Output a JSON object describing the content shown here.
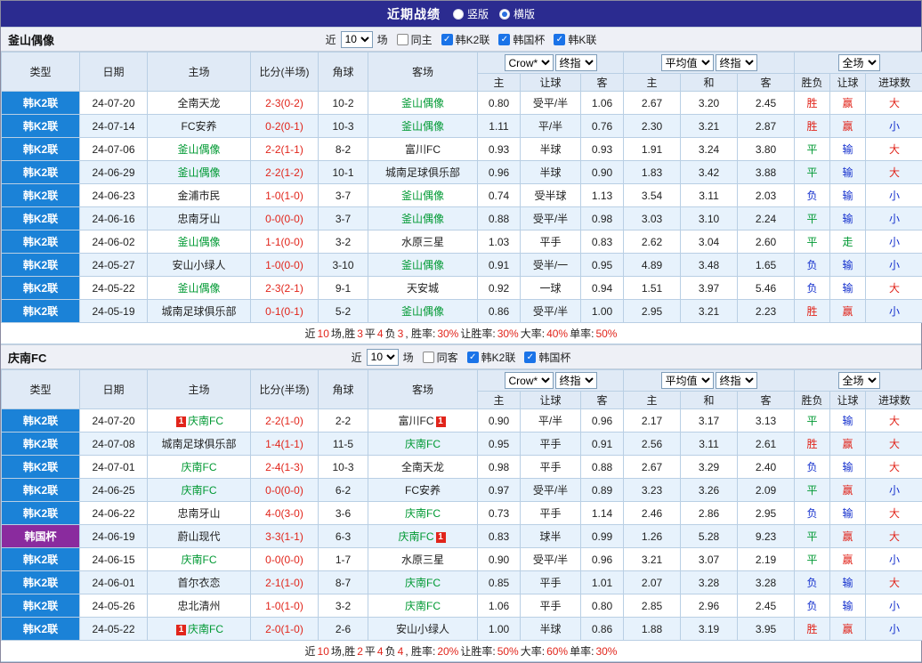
{
  "topbar": {
    "title": "近期战绩",
    "radios": [
      {
        "label": "竖版",
        "selected": false
      },
      {
        "label": "横版",
        "selected": true
      }
    ]
  },
  "table_header": {
    "cols": [
      "类型",
      "日期",
      "主场",
      "比分(半场)",
      "角球",
      "客场"
    ],
    "groups": [
      {
        "sel1": "Crow*",
        "sel2": "终指"
      },
      {
        "sel1": "平均值",
        "sel2": "终指"
      },
      {
        "sel1": "全场"
      }
    ],
    "sub": [
      "主",
      "让球",
      "客",
      "主",
      "和",
      "客",
      "胜负",
      "让球",
      "进球数"
    ]
  },
  "result_colors": {
    "胜": "red",
    "赢": "red",
    "大": "red",
    "平": "green",
    "走": "green",
    "负": "blue",
    "输": "blue",
    "小": "blue"
  },
  "colors": {
    "k2_league": "#1b82d7",
    "cup": "#8a2b9e",
    "win": "#e1251b",
    "draw": "#009933",
    "lose": "#1430cd",
    "focal_team": "#009933",
    "topbar_bg": "#2b2b90"
  },
  "sections": [
    {
      "team": "釜山偶像",
      "filters": {
        "near_label": "近",
        "count": "10",
        "games_label": "场",
        "checkboxes": [
          {
            "label": "同主",
            "checked": false
          },
          {
            "label": "韩K2联",
            "checked": true
          },
          {
            "label": "韩国杯",
            "checked": true
          },
          {
            "label": "韩K联",
            "checked": true
          }
        ]
      },
      "rows": [
        {
          "type": "韩K2联",
          "tclass": "k2",
          "date": "24-07-20",
          "home": "全南天龙",
          "hf": false,
          "hb": false,
          "score": "2-3(0-2)",
          "corner": "10-2",
          "away": "釜山偶像",
          "af": true,
          "ab": false,
          "odds": [
            "0.80",
            "受平/半",
            "1.06",
            "2.67",
            "3.20",
            "2.45"
          ],
          "res": [
            "胜",
            "赢",
            "大"
          ]
        },
        {
          "type": "韩K2联",
          "tclass": "k2",
          "date": "24-07-14",
          "home": "FC安养",
          "hf": false,
          "hb": false,
          "score": "0-2(0-1)",
          "corner": "10-3",
          "away": "釜山偶像",
          "af": true,
          "ab": false,
          "odds": [
            "1.11",
            "平/半",
            "0.76",
            "2.30",
            "3.21",
            "2.87"
          ],
          "res": [
            "胜",
            "赢",
            "小"
          ]
        },
        {
          "type": "韩K2联",
          "tclass": "k2",
          "date": "24-07-06",
          "home": "釜山偶像",
          "hf": true,
          "hb": false,
          "score": "2-2(1-1)",
          "corner": "8-2",
          "away": "富川FC",
          "af": false,
          "ab": false,
          "odds": [
            "0.93",
            "半球",
            "0.93",
            "1.91",
            "3.24",
            "3.80"
          ],
          "res": [
            "平",
            "输",
            "大"
          ]
        },
        {
          "type": "韩K2联",
          "tclass": "k2",
          "date": "24-06-29",
          "home": "釜山偶像",
          "hf": true,
          "hb": false,
          "score": "2-2(1-2)",
          "corner": "10-1",
          "away": "城南足球俱乐部",
          "af": false,
          "ab": false,
          "odds": [
            "0.96",
            "半球",
            "0.90",
            "1.83",
            "3.42",
            "3.88"
          ],
          "res": [
            "平",
            "输",
            "大"
          ]
        },
        {
          "type": "韩K2联",
          "tclass": "k2",
          "date": "24-06-23",
          "home": "金浦市民",
          "hf": false,
          "hb": false,
          "score": "1-0(1-0)",
          "corner": "3-7",
          "away": "釜山偶像",
          "af": true,
          "ab": false,
          "odds": [
            "0.74",
            "受半球",
            "1.13",
            "3.54",
            "3.11",
            "2.03"
          ],
          "res": [
            "负",
            "输",
            "小"
          ]
        },
        {
          "type": "韩K2联",
          "tclass": "k2",
          "date": "24-06-16",
          "home": "忠南牙山",
          "hf": false,
          "hb": false,
          "score": "0-0(0-0)",
          "corner": "3-7",
          "away": "釜山偶像",
          "af": true,
          "ab": false,
          "odds": [
            "0.88",
            "受平/半",
            "0.98",
            "3.03",
            "3.10",
            "2.24"
          ],
          "res": [
            "平",
            "输",
            "小"
          ]
        },
        {
          "type": "韩K2联",
          "tclass": "k2",
          "date": "24-06-02",
          "home": "釜山偶像",
          "hf": true,
          "hb": false,
          "score": "1-1(0-0)",
          "corner": "3-2",
          "away": "水原三星",
          "af": false,
          "ab": false,
          "odds": [
            "1.03",
            "平手",
            "0.83",
            "2.62",
            "3.04",
            "2.60"
          ],
          "res": [
            "平",
            "走",
            "小"
          ]
        },
        {
          "type": "韩K2联",
          "tclass": "k2",
          "date": "24-05-27",
          "home": "安山小绿人",
          "hf": false,
          "hb": false,
          "score": "1-0(0-0)",
          "corner": "3-10",
          "away": "釜山偶像",
          "af": true,
          "ab": false,
          "odds": [
            "0.91",
            "受半/一",
            "0.95",
            "4.89",
            "3.48",
            "1.65"
          ],
          "res": [
            "负",
            "输",
            "小"
          ]
        },
        {
          "type": "韩K2联",
          "tclass": "k2",
          "date": "24-05-22",
          "home": "釜山偶像",
          "hf": true,
          "hb": false,
          "score": "2-3(2-1)",
          "corner": "9-1",
          "away": "天安城",
          "af": false,
          "ab": false,
          "odds": [
            "0.92",
            "一球",
            "0.94",
            "1.51",
            "3.97",
            "5.46"
          ],
          "res": [
            "负",
            "输",
            "大"
          ]
        },
        {
          "type": "韩K2联",
          "tclass": "k2",
          "date": "24-05-19",
          "home": "城南足球俱乐部",
          "hf": false,
          "hb": false,
          "score": "0-1(0-1)",
          "corner": "5-2",
          "away": "釜山偶像",
          "af": true,
          "ab": false,
          "odds": [
            "0.86",
            "受平/半",
            "1.00",
            "2.95",
            "3.21",
            "2.23"
          ],
          "res": [
            "胜",
            "赢",
            "小"
          ]
        }
      ],
      "footer": [
        {
          "t": "近",
          "c": "k"
        },
        {
          "t": "10",
          "c": "r"
        },
        {
          "t": "场,胜",
          "c": "k"
        },
        {
          "t": "3",
          "c": "r"
        },
        {
          "t": "平",
          "c": "k"
        },
        {
          "t": "4",
          "c": "r"
        },
        {
          "t": "负",
          "c": "k"
        },
        {
          "t": "3",
          "c": "r"
        },
        {
          "t": ", 胜率:",
          "c": "k"
        },
        {
          "t": "30%",
          "c": "r"
        },
        {
          "t": " 让胜率:",
          "c": "k"
        },
        {
          "t": "30%",
          "c": "r"
        },
        {
          "t": " 大率:",
          "c": "k"
        },
        {
          "t": "40%",
          "c": "r"
        },
        {
          "t": " 单率:",
          "c": "k"
        },
        {
          "t": "50%",
          "c": "r"
        }
      ]
    },
    {
      "team": "庆南FC",
      "filters": {
        "near_label": "近",
        "count": "10",
        "games_label": "场",
        "checkboxes": [
          {
            "label": "同客",
            "checked": false
          },
          {
            "label": "韩K2联",
            "checked": true
          },
          {
            "label": "韩国杯",
            "checked": true
          }
        ]
      },
      "rows": [
        {
          "type": "韩K2联",
          "tclass": "k2",
          "date": "24-07-20",
          "home": "庆南FC",
          "hf": true,
          "hb": true,
          "score": "2-2(1-0)",
          "corner": "2-2",
          "away": "富川FC",
          "af": false,
          "ab": true,
          "odds": [
            "0.90",
            "平/半",
            "0.96",
            "2.17",
            "3.17",
            "3.13"
          ],
          "res": [
            "平",
            "输",
            "大"
          ]
        },
        {
          "type": "韩K2联",
          "tclass": "k2",
          "date": "24-07-08",
          "home": "城南足球俱乐部",
          "hf": false,
          "hb": false,
          "score": "1-4(1-1)",
          "corner": "11-5",
          "away": "庆南FC",
          "af": true,
          "ab": false,
          "odds": [
            "0.95",
            "平手",
            "0.91",
            "2.56",
            "3.11",
            "2.61"
          ],
          "res": [
            "胜",
            "赢",
            "大"
          ]
        },
        {
          "type": "韩K2联",
          "tclass": "k2",
          "date": "24-07-01",
          "home": "庆南FC",
          "hf": true,
          "hb": false,
          "score": "2-4(1-3)",
          "corner": "10-3",
          "away": "全南天龙",
          "af": false,
          "ab": false,
          "odds": [
            "0.98",
            "平手",
            "0.88",
            "2.67",
            "3.29",
            "2.40"
          ],
          "res": [
            "负",
            "输",
            "大"
          ]
        },
        {
          "type": "韩K2联",
          "tclass": "k2",
          "date": "24-06-25",
          "home": "庆南FC",
          "hf": true,
          "hb": false,
          "score": "0-0(0-0)",
          "corner": "6-2",
          "away": "FC安养",
          "af": false,
          "ab": false,
          "odds": [
            "0.97",
            "受平/半",
            "0.89",
            "3.23",
            "3.26",
            "2.09"
          ],
          "res": [
            "平",
            "赢",
            "小"
          ]
        },
        {
          "type": "韩K2联",
          "tclass": "k2",
          "date": "24-06-22",
          "home": "忠南牙山",
          "hf": false,
          "hb": false,
          "score": "4-0(3-0)",
          "corner": "3-6",
          "away": "庆南FC",
          "af": true,
          "ab": false,
          "odds": [
            "0.73",
            "平手",
            "1.14",
            "2.46",
            "2.86",
            "2.95"
          ],
          "res": [
            "负",
            "输",
            "大"
          ]
        },
        {
          "type": "韩国杯",
          "tclass": "cup",
          "date": "24-06-19",
          "home": "蔚山现代",
          "hf": false,
          "hb": false,
          "score": "3-3(1-1)",
          "corner": "6-3",
          "away": "庆南FC",
          "af": true,
          "ab": true,
          "odds": [
            "0.83",
            "球半",
            "0.99",
            "1.26",
            "5.28",
            "9.23"
          ],
          "res": [
            "平",
            "赢",
            "大"
          ]
        },
        {
          "type": "韩K2联",
          "tclass": "k2",
          "date": "24-06-15",
          "home": "庆南FC",
          "hf": true,
          "hb": false,
          "score": "0-0(0-0)",
          "corner": "1-7",
          "away": "水原三星",
          "af": false,
          "ab": false,
          "odds": [
            "0.90",
            "受平/半",
            "0.96",
            "3.21",
            "3.07",
            "2.19"
          ],
          "res": [
            "平",
            "赢",
            "小"
          ]
        },
        {
          "type": "韩K2联",
          "tclass": "k2",
          "date": "24-06-01",
          "home": "首尔衣恋",
          "hf": false,
          "hb": false,
          "score": "2-1(1-0)",
          "corner": "8-7",
          "away": "庆南FC",
          "af": true,
          "ab": false,
          "odds": [
            "0.85",
            "平手",
            "1.01",
            "2.07",
            "3.28",
            "3.28"
          ],
          "res": [
            "负",
            "输",
            "大"
          ]
        },
        {
          "type": "韩K2联",
          "tclass": "k2",
          "date": "24-05-26",
          "home": "忠北清州",
          "hf": false,
          "hb": false,
          "score": "1-0(1-0)",
          "corner": "3-2",
          "away": "庆南FC",
          "af": true,
          "ab": false,
          "odds": [
            "1.06",
            "平手",
            "0.80",
            "2.85",
            "2.96",
            "2.45"
          ],
          "res": [
            "负",
            "输",
            "小"
          ]
        },
        {
          "type": "韩K2联",
          "tclass": "k2",
          "date": "24-05-22",
          "home": "庆南FC",
          "hf": true,
          "hb": true,
          "score": "2-0(1-0)",
          "corner": "2-6",
          "away": "安山小绿人",
          "af": false,
          "ab": false,
          "odds": [
            "1.00",
            "半球",
            "0.86",
            "1.88",
            "3.19",
            "3.95"
          ],
          "res": [
            "胜",
            "赢",
            "小"
          ]
        }
      ],
      "footer": [
        {
          "t": "近",
          "c": "k"
        },
        {
          "t": "10",
          "c": "r"
        },
        {
          "t": "场,胜",
          "c": "k"
        },
        {
          "t": "2",
          "c": "r"
        },
        {
          "t": "平",
          "c": "k"
        },
        {
          "t": "4",
          "c": "r"
        },
        {
          "t": "负",
          "c": "k"
        },
        {
          "t": "4",
          "c": "r"
        },
        {
          "t": ", 胜率:",
          "c": "k"
        },
        {
          "t": "20%",
          "c": "r"
        },
        {
          "t": " 让胜率:",
          "c": "k"
        },
        {
          "t": "50%",
          "c": "r"
        },
        {
          "t": " 大率:",
          "c": "k"
        },
        {
          "t": "60%",
          "c": "r"
        },
        {
          "t": " 单率:",
          "c": "k"
        },
        {
          "t": "30%",
          "c": "r"
        }
      ]
    }
  ]
}
